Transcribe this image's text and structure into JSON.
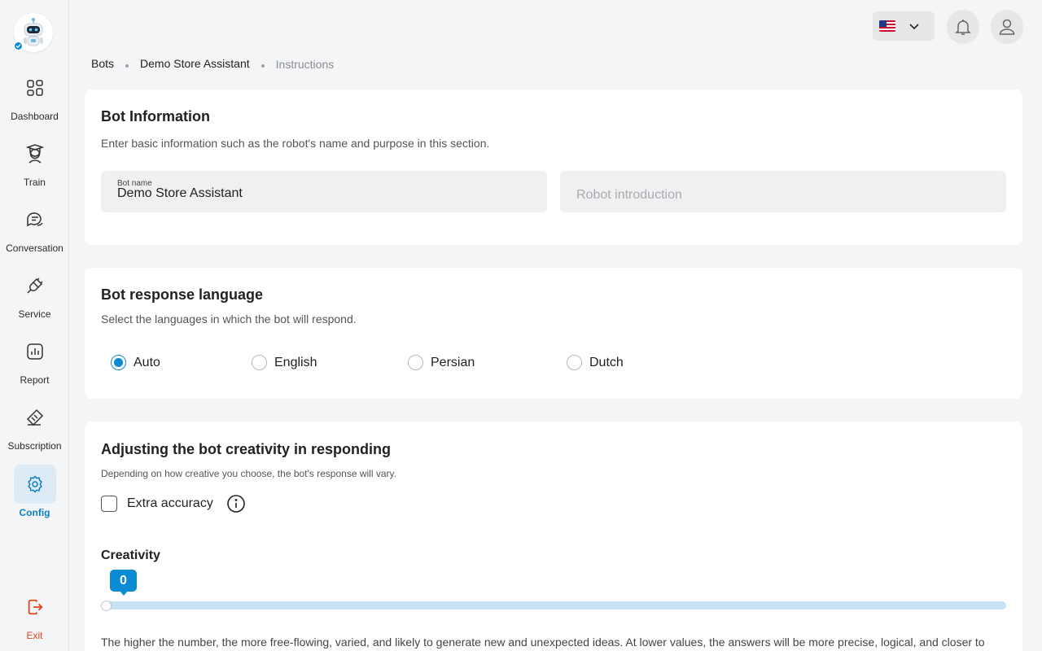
{
  "sidebar": {
    "logo_icon": "robot-icon",
    "items": [
      {
        "label": "Dashboard",
        "icon": "grid-icon",
        "active": false
      },
      {
        "label": "Train",
        "icon": "graduate-icon",
        "active": false
      },
      {
        "label": "Conversation",
        "icon": "chat-icon",
        "active": false
      },
      {
        "label": "Service",
        "icon": "plug-icon",
        "active": false
      },
      {
        "label": "Report",
        "icon": "bar-chart-icon",
        "active": false
      },
      {
        "label": "Subscription",
        "icon": "ticket-icon",
        "active": false
      },
      {
        "label": "Config",
        "icon": "gear-icon",
        "active": true
      }
    ],
    "exit_label": "Exit"
  },
  "header": {
    "language_flag": "us-flag-icon",
    "notification_icon": "bell-icon",
    "profile_icon": "user-icon"
  },
  "breadcrumb": [
    "Bots",
    "Demo Store Assistant",
    "Instructions"
  ],
  "bot_info": {
    "title": "Bot Information",
    "description": "Enter basic information such as the robot's name and purpose in this section.",
    "name_label": "Bot name",
    "name_value": "Demo Store Assistant",
    "intro_placeholder": "Robot introduction"
  },
  "response_language": {
    "title": "Bot response language",
    "description": "Select the languages in which the bot will respond.",
    "options": [
      "Auto",
      "English",
      "Persian",
      "Dutch"
    ],
    "selected": "Auto"
  },
  "creativity": {
    "title": "Adjusting the bot creativity in responding",
    "description": "Depending on how creative you choose, the bot's response will vary.",
    "extra_accuracy_label": "Extra accuracy",
    "extra_accuracy_checked": false,
    "slider_label": "Creativity",
    "slider_value": "0",
    "note": "The higher the number, the more free-flowing, varied, and likely to generate new and unexpected ideas. At lower values, the answers will be more precise, logical, and closer to"
  },
  "colors": {
    "accent": "#0b8bd3",
    "exit": "#e0471b",
    "slider_track": "#c5e2f2"
  }
}
